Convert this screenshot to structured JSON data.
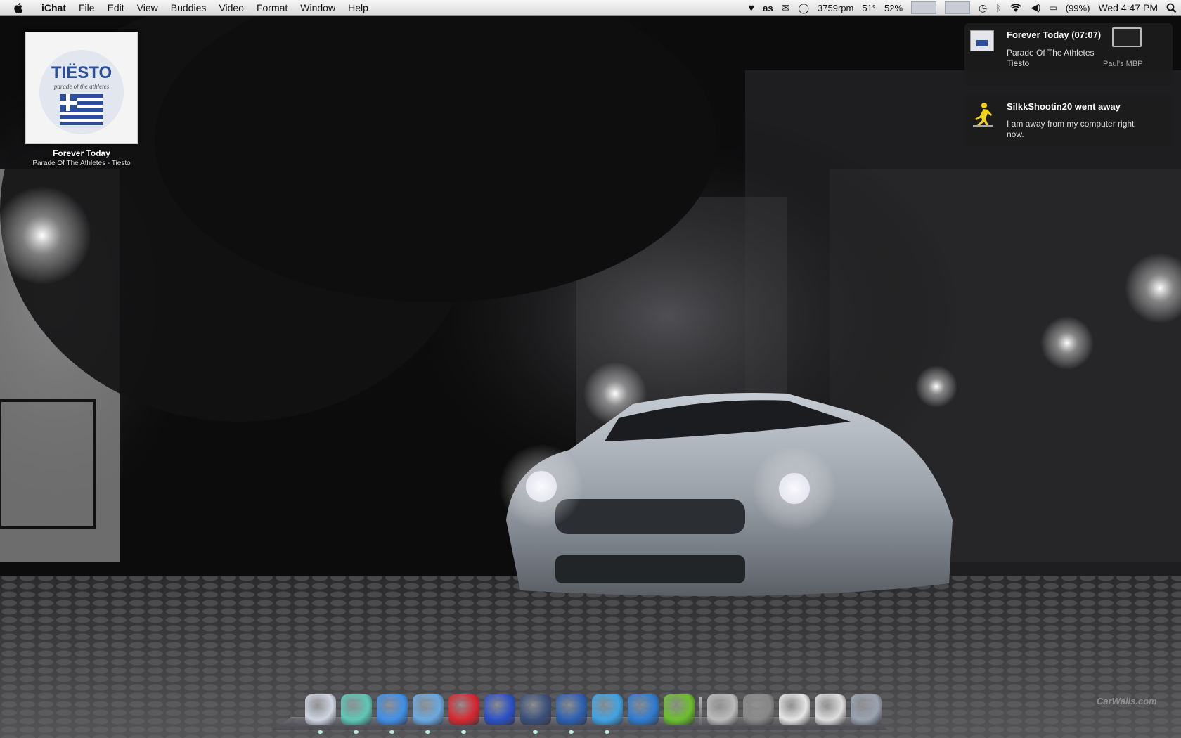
{
  "menubar": {
    "app_name": "iChat",
    "menus": [
      "File",
      "Edit",
      "View",
      "Buddies",
      "Video",
      "Format",
      "Window",
      "Help"
    ],
    "status_icons": [
      "heart-icon",
      "lastfm-icon",
      "mail-icon",
      "ichat-status-icon"
    ],
    "fan_speed": "3759rpm",
    "temperature": "51°",
    "cpu": "52%",
    "battery": "(99%)",
    "clock": "Wed 4:47 PM"
  },
  "now_playing": {
    "album_art_text": "TIËSTO",
    "album_art_script": "parade of the athletes",
    "track": "Forever Today",
    "album_artist": "Parade Of The Athletes - Tiesto"
  },
  "notifications": [
    {
      "title": "Forever Today (07:07)",
      "line1": "Parade Of The Athletes",
      "line2": "Tiesto",
      "source": "Paul's MBP"
    },
    {
      "title": "SilkkShootin20 went away",
      "message_line1": "I am away from my computer right",
      "message_line2": "now."
    }
  ],
  "watermark": "CarWalls.com",
  "dock": {
    "apps": [
      {
        "name": "finder-icon",
        "color": "#cfd6e2",
        "running": true
      },
      {
        "name": "adium-icon",
        "color": "#5ec8b8",
        "running": true
      },
      {
        "name": "ichat-icon",
        "color": "#3f8fe8",
        "running": true
      },
      {
        "name": "itunes-icon",
        "color": "#6aa9e0",
        "running": true
      },
      {
        "name": "lastfm-icon",
        "color": "#d8262f",
        "running": true
      },
      {
        "name": "cyberduck-icon",
        "color": "#2a4fc8",
        "running": false
      },
      {
        "name": "camino-icon",
        "color": "#3a4f7a",
        "running": true
      },
      {
        "name": "firefox-icon",
        "color": "#2b5fb0",
        "running": true
      },
      {
        "name": "quill-icon",
        "color": "#3fa3e3",
        "running": true
      },
      {
        "name": "word-icon",
        "color": "#2d7bd0",
        "running": false
      },
      {
        "name": "transmission-icon",
        "color": "#6bbf2c",
        "running": false
      }
    ],
    "stacks": [
      {
        "name": "applications-stack-icon",
        "color": "#bbbbbb"
      },
      {
        "name": "dvd-player-icon",
        "color": "#888888"
      },
      {
        "name": "documents-stack-icon",
        "color": "#e6e6e6"
      },
      {
        "name": "downloads-stack-icon",
        "color": "#dedede"
      },
      {
        "name": "trash-icon",
        "color": "#9aa3b0"
      }
    ]
  }
}
